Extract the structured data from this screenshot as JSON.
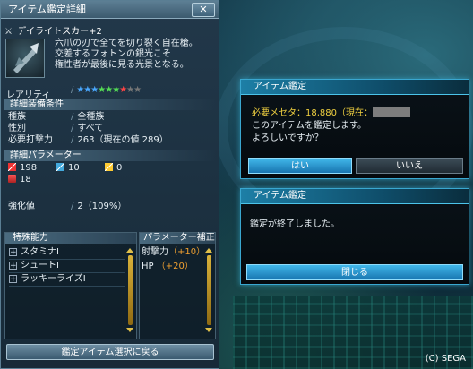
{
  "window": {
    "title": "アイテム鑑定詳細",
    "close_label": "✕"
  },
  "item": {
    "name": "デイライトスカー+2",
    "description": [
      "六爪の刃で全てを切り裂く自在槍。",
      "交差するフォトンの銀光こそ",
      "権性者が最後に見る光景となる。"
    ]
  },
  "rarity": {
    "label": "レアリティ",
    "stars_blue": "★★★",
    "stars_green": "★★★",
    "stars_red": "★",
    "stars_gray": "★★",
    "value": 7,
    "max": 10
  },
  "conditions": {
    "section_title": "詳細装備条件",
    "rows": [
      {
        "label": "種族",
        "value": "全種族"
      },
      {
        "label": "性別",
        "value": "すべて"
      },
      {
        "label": "必要打撃力",
        "value": "263（現在の値 289）"
      }
    ]
  },
  "parameters": {
    "section_title": "詳細パラメーター",
    "sword": "198",
    "arrow": "10",
    "staff": "0",
    "hp": "18"
  },
  "grind": {
    "label": "強化値",
    "value": "2（109%）"
  },
  "abilities": {
    "title": "特殊能力",
    "items": [
      "スタミナⅠ",
      "シュートⅠ",
      "ラッキーライズⅠ"
    ]
  },
  "param_bonus": {
    "title": "パラメーター補正",
    "rows": [
      {
        "label": "射撃力",
        "value": "（+10）"
      },
      {
        "label": "HP",
        "value": "（+20）"
      }
    ]
  },
  "back_button": "鑑定アイテム選択に戻る",
  "confirm_dialog": {
    "title": "アイテム鑑定",
    "cost_line": "必要メセタ：18,880（現在：",
    "message1": "このアイテムを鑑定します。",
    "message2": "よろしいですか？",
    "yes": "はい",
    "no": "いいえ"
  },
  "done_dialog": {
    "title": "アイテム鑑定",
    "message": "鑑定が終了しました。",
    "close": "閉じる"
  },
  "copyright": "(C) SEGA",
  "colors": {
    "accent": "#3aa7d0",
    "cost_text": "#f0d040",
    "bonus_value": "#f0a030",
    "star_blue": "#4aa8ff",
    "star_green": "#55dd55",
    "star_red": "#ff4444",
    "star_gray": "#777777"
  }
}
